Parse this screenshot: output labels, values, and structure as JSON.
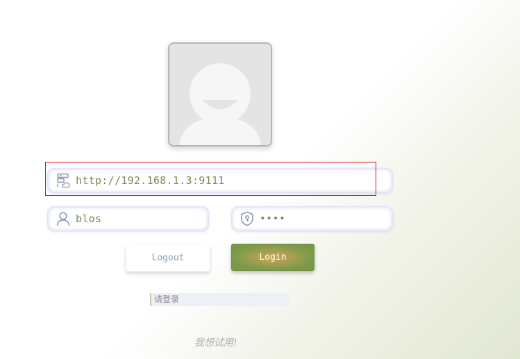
{
  "login_form": {
    "server": {
      "value": "http://192.168.1.3:9111",
      "icon": "server-cloud-icon"
    },
    "username": {
      "value": "blos",
      "icon": "user-icon"
    },
    "password": {
      "value": "••••",
      "icon": "shield-key-icon"
    },
    "buttons": {
      "logout_label": "Logout",
      "login_label": "Login"
    },
    "status_text": "请登录",
    "trial_link_text": "我想试用!"
  },
  "avatar": {
    "icon": "default-avatar-icon"
  },
  "colors": {
    "input_text": "#7b8a52",
    "icon": "#8893b5",
    "login_button": "#7a9a4a",
    "highlight_box": "#d8141f"
  }
}
